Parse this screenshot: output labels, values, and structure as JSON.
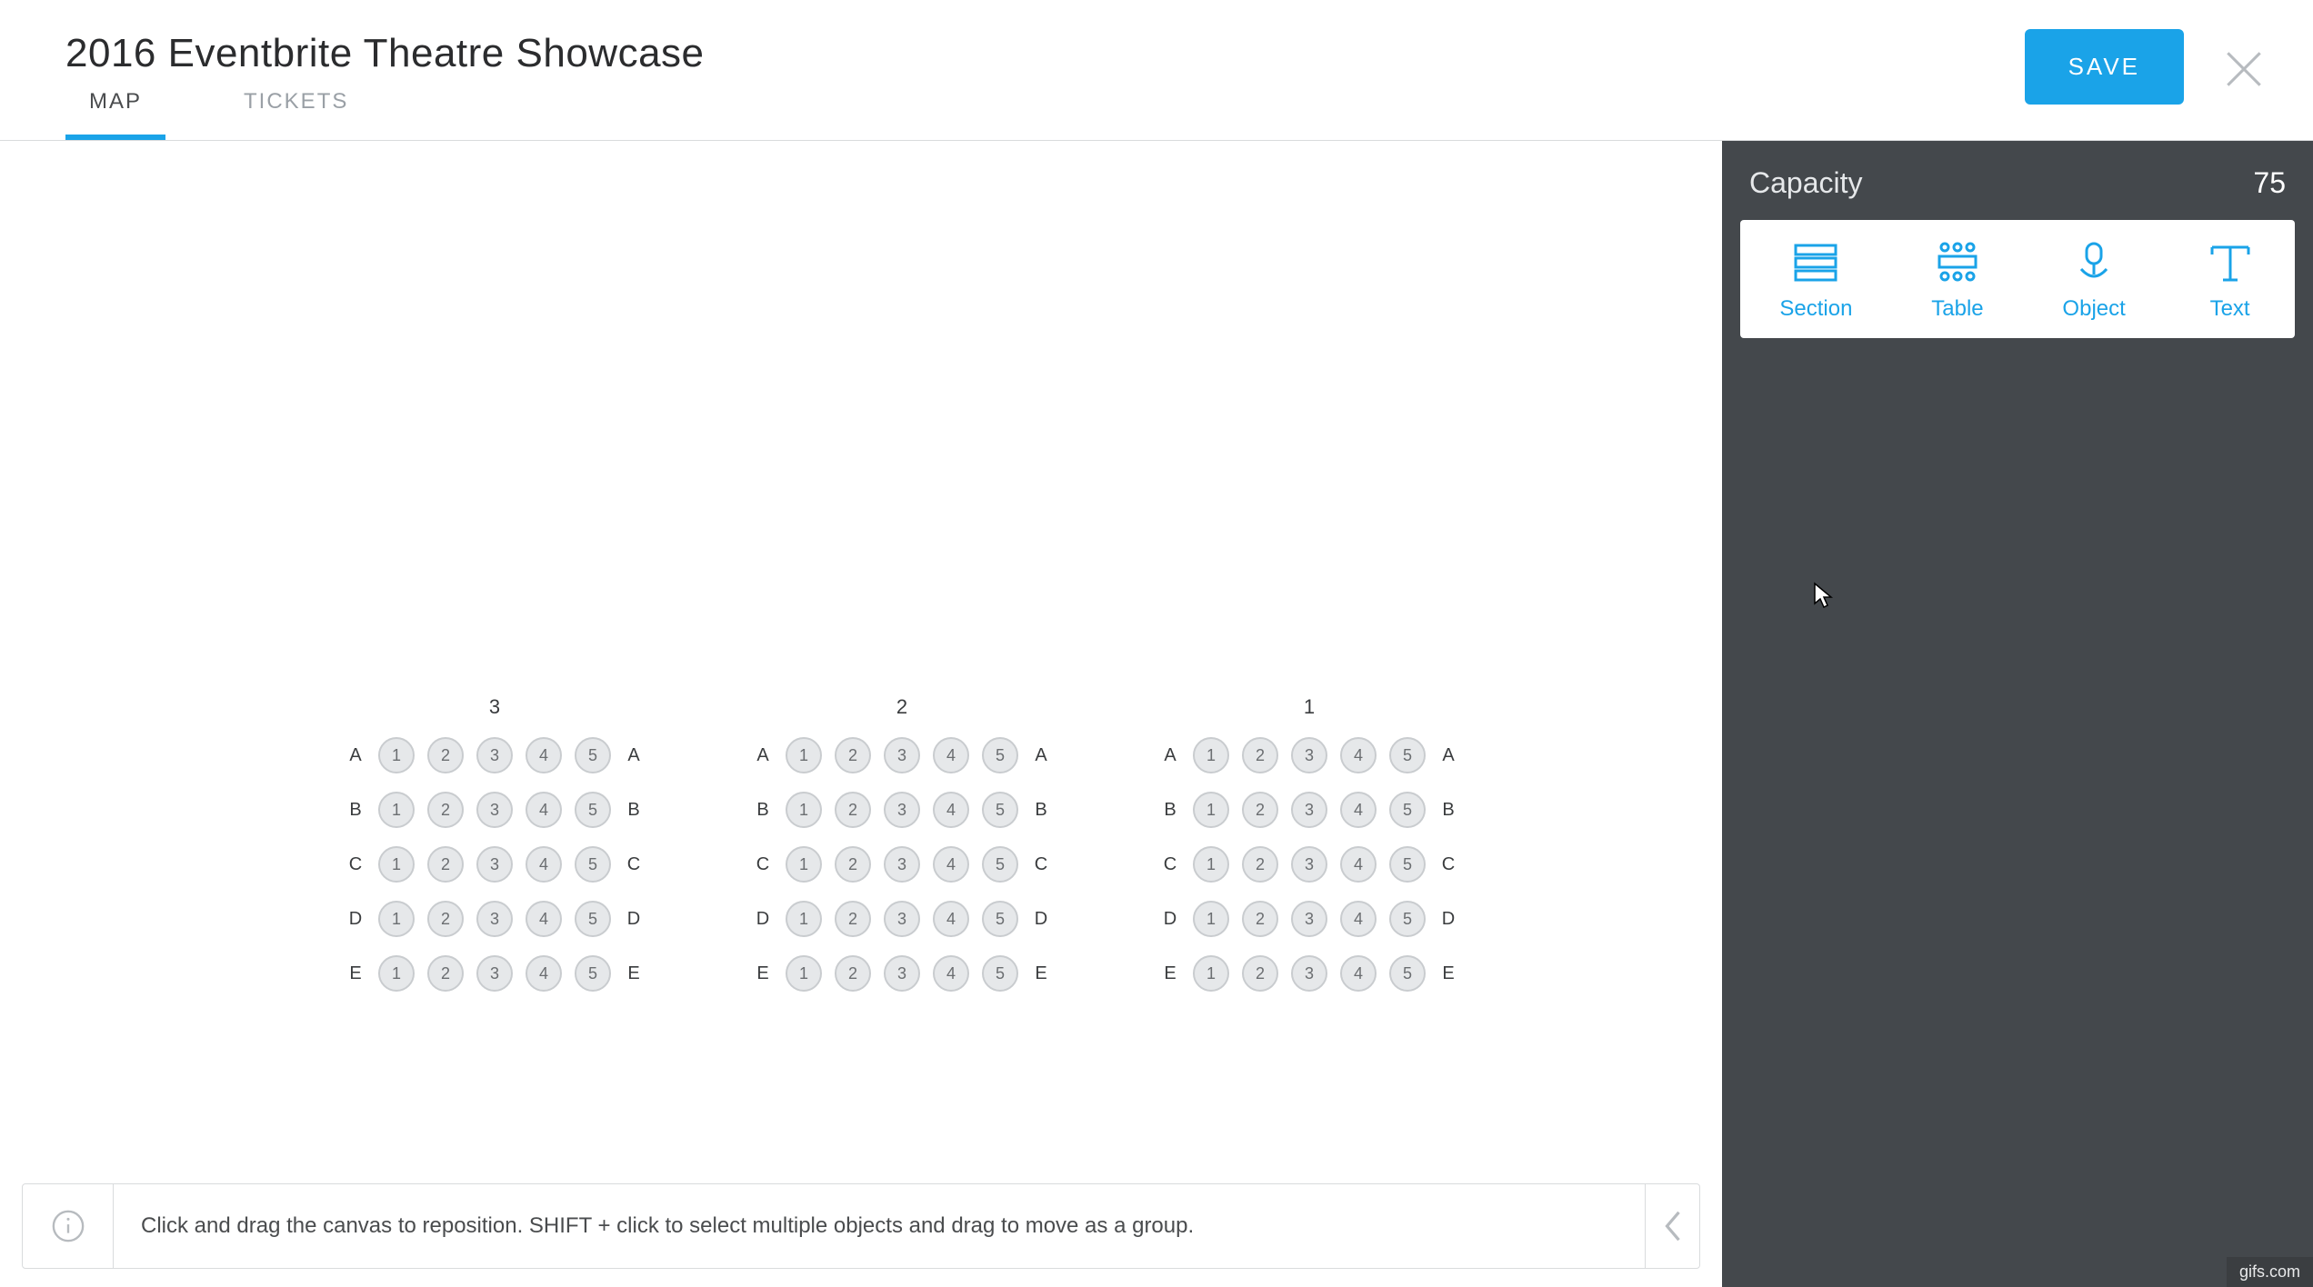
{
  "header": {
    "title": "2016 Eventbrite Theatre Showcase",
    "tabs": [
      {
        "label": "MAP",
        "active": true
      },
      {
        "label": "TICKETS",
        "active": false
      }
    ],
    "save_label": "SAVE"
  },
  "sidebar": {
    "capacity_label": "Capacity",
    "capacity_value": "75",
    "tools": [
      {
        "name": "section",
        "label": "Section"
      },
      {
        "name": "table",
        "label": "Table"
      },
      {
        "name": "object",
        "label": "Object"
      },
      {
        "name": "text",
        "label": "Text"
      }
    ]
  },
  "canvas": {
    "sections": [
      {
        "label": "3",
        "rows": [
          "A",
          "B",
          "C",
          "D",
          "E"
        ],
        "seats_per_row": [
          "1",
          "2",
          "3",
          "4",
          "5"
        ]
      },
      {
        "label": "2",
        "rows": [
          "A",
          "B",
          "C",
          "D",
          "E"
        ],
        "seats_per_row": [
          "1",
          "2",
          "3",
          "4",
          "5"
        ]
      },
      {
        "label": "1",
        "rows": [
          "A",
          "B",
          "C",
          "D",
          "E"
        ],
        "seats_per_row": [
          "1",
          "2",
          "3",
          "4",
          "5"
        ]
      }
    ],
    "hint_text": "Click and drag the canvas to reposition. SHIFT + click to select multiple objects and drag to move as a group."
  },
  "watermark": "gifs.com"
}
